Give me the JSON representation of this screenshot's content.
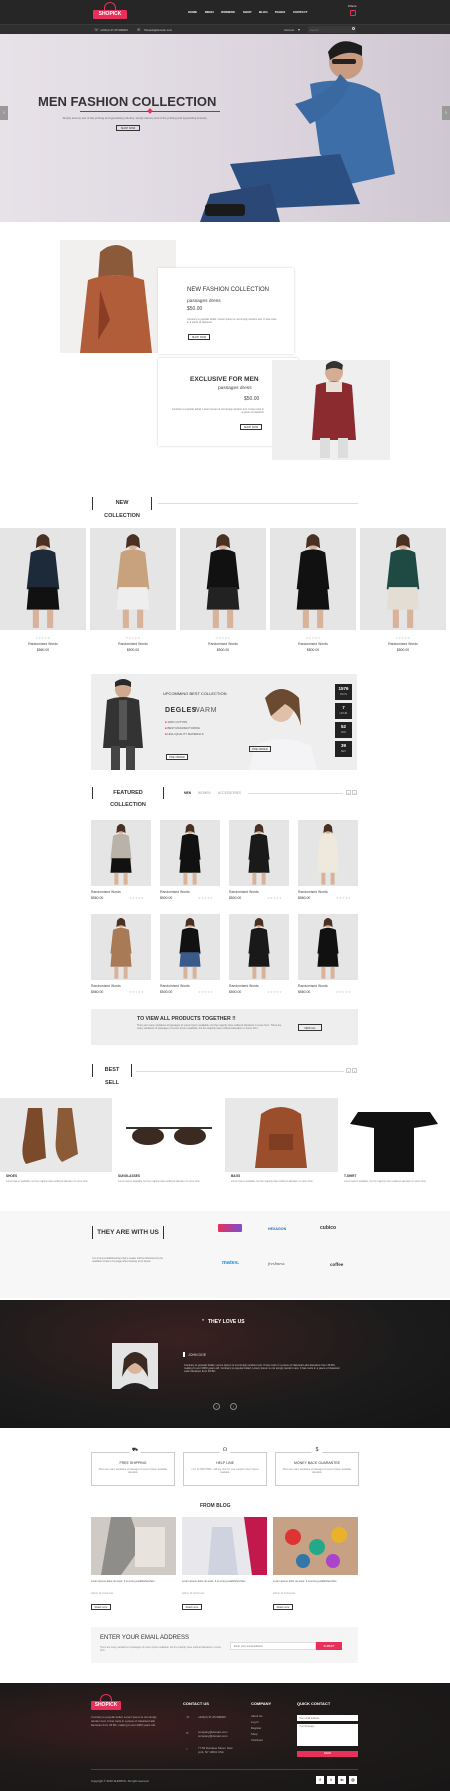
{
  "header": {
    "logo": "SHOPICK",
    "cart_label": "0 Item",
    "nav": [
      "HOME",
      "MENU",
      "WOMENS",
      "SHOP",
      "BLOG",
      "PAGES",
      "CONTACT"
    ],
    "phone": "+001(2) 37-25 999000",
    "email": "Shopick@domain.com",
    "account": "Account",
    "search_placeholder": "Search"
  },
  "hero": {
    "title": "MEN FASHION COLLECTION",
    "text": "Simply dummy text of the printing and typesetting industry. simply dummy text of the printing and typesetting industry.",
    "button": "SHOP NOW"
  },
  "promo": {
    "a_title": "NEW FASHION COLLECTION",
    "a_sub": "passages dress",
    "a_price": "$50.00",
    "a_text": "Contrary to popular belief, Lorem Ipsum is not simply random text. It has roots in a piece of classical.",
    "a_btn": "SHOP NOW",
    "b_title": "EXCLUSIVE FOR MEN",
    "b_sub": "passages dress",
    "b_price": "$50.00",
    "b_text": "Contrary to popular belief, Lorem Ipsum is not simply random text. It has roots in a piece of classical.",
    "b_btn": "SHOP NOW"
  },
  "new_collection": {
    "title": "NEW COLLECTION",
    "items": [
      {
        "name": "Randomised Words",
        "price": "$560.00"
      },
      {
        "name": "Randomised Words",
        "price": "$500.00"
      },
      {
        "name": "Randomised Words",
        "price": "$500.00"
      },
      {
        "name": "Randomised Words",
        "price": "$500.00"
      },
      {
        "name": "Randomised Words",
        "price": "$500.00"
      }
    ]
  },
  "upcoming": {
    "label": "UPCOMMING BEST COLLECTION",
    "brand": "DEGLES",
    "brand2": "WARM",
    "features": [
      "100% COTTON",
      "BEST MANUFACTURING",
      "HIGH QUALITY MATERIALS"
    ],
    "btn1": "PRE ORDER",
    "btn2": "PRE ORDER",
    "countdown": [
      {
        "n": "1576",
        "l": "DAYS"
      },
      {
        "n": "7",
        "l": "HOUR"
      },
      {
        "n": "52",
        "l": "MIN"
      },
      {
        "n": "39",
        "l": "SEC"
      }
    ]
  },
  "featured": {
    "title": "FEATURED COLLECTION",
    "tabs": [
      "MEN",
      "WOMEN",
      "ACCESSORIES"
    ],
    "items": [
      {
        "name": "Randomised Words",
        "price": "$560.00"
      },
      {
        "name": "Randomised Words",
        "price": "$500.00"
      },
      {
        "name": "Randomised Words",
        "price": "$500.00"
      },
      {
        "name": "Randomised Words",
        "price": "$560.00"
      },
      {
        "name": "Randomised Words",
        "price": "$560.00"
      },
      {
        "name": "Randomised Words",
        "price": "$500.00"
      },
      {
        "name": "Randomised Words",
        "price": "$500.00"
      },
      {
        "name": "Randomised Words",
        "price": "$560.00"
      }
    ]
  },
  "view_all": {
    "title": "TO VIEW ALL PRODUCTS TOGETHER !!",
    "text": "There are many variations of passages of Lorem Ipsum available, but the majority have suffered alteration in some form. There are many variations of passages of Lorem Ipsum available, but the majority have suffered alteration in some form.",
    "btn": "VIEW ALL"
  },
  "best_sell": {
    "title": "BEST SELL",
    "items": [
      {
        "name": "SHOES",
        "text": "Lorem Ipsum available, but the majority have suffered alteration in some form."
      },
      {
        "name": "SUNGLASSES",
        "text": "Lorem Ipsum available, but the majority have suffered alteration in some form."
      },
      {
        "name": "BAGS",
        "text": "Lorem Ipsum available, but the majority have suffered alteration in some form."
      },
      {
        "name": "T-SHIRT",
        "text": "Lorem Ipsum available, but the majority have suffered alteration in some form."
      }
    ]
  },
  "partners": {
    "title": "THEY ARE WITH US",
    "text": "It is a long established fact that a reader will be distracted by the readable content of a page when looking at its layout.",
    "logos": [
      "HEXAGON",
      "cubico",
      "mates.",
      "freshness",
      "coffee"
    ]
  },
  "testimonial": {
    "title": "THEY LOVE US",
    "name": "JOHN DOE",
    "text": "Contrary to popular belief, Lorem Ipsum is not simply random text. It has roots in a piece of classical Latin literature from 45 BC, making it over 2000 years old. Contrary to popular belief, Lorem Ipsum is not simply random text. It has roots in a piece of classical Latin literature from 45 BC."
  },
  "features": [
    {
      "title": "FREE SHIPPING",
      "text": "There are many variations of passages of Lorem Ipsum available, alteration"
    },
    {
      "title": "HELP LINE",
      "text": "+1 0 12 345 67890 - call any time for your support Lorem Ipsum available"
    },
    {
      "title": "MONEY BACK GUARANTEE",
      "text": "There are many variations of passages of Lorem Ipsum available, alteration"
    }
  ],
  "blog": {
    "title": "FROM BLOG",
    "posts": [
      {
        "text": "Lorem ipsum dolor sit amet. It is a long established fact.",
        "meta": "Admin  12 Comments",
        "btn": "Read more"
      },
      {
        "text": "Lorem ipsum dolor sit amet. It is a long established fact.",
        "meta": "Admin  12 Comments",
        "btn": "Read more"
      },
      {
        "text": "Lorem ipsum dolor sit amet. It is a long established fact.",
        "meta": "Admin  12 Comments",
        "btn": "Read more"
      }
    ]
  },
  "newsletter": {
    "title": "ENTER YOUR EMAIL ADDRESS",
    "text": "There are many variations of passages of Lorem Ipsum available, but the majority have suffered alteration in some form.",
    "placeholder": "Enter your email address",
    "btn": "SUBMIT"
  },
  "footer": {
    "logo": "SHOPICK",
    "text": "Contrary to popular belief, Lorem Ipsum is not simply random text. It has roots in a piece of classical Latin literature from 45 BC, making it over 2000 years old.",
    "contact_title": "CONTACT US",
    "contact": [
      "+001(2) 37-25 999000",
      "company@domain.com company@domain.com",
      "77-56 Rontique Street, New york, NY 10001 USA"
    ],
    "company_title": "COMPANY",
    "company": [
      "About Us",
      "Log In",
      "Register",
      "Shop",
      "Checkout"
    ],
    "quick_title": "QUICK CONTACT",
    "quick_fields": [
      "Your email address",
      "Your Message"
    ],
    "quick_btn": "SEND",
    "copyright": "Copyright © 2016 SHOPICK. All right reserved"
  }
}
